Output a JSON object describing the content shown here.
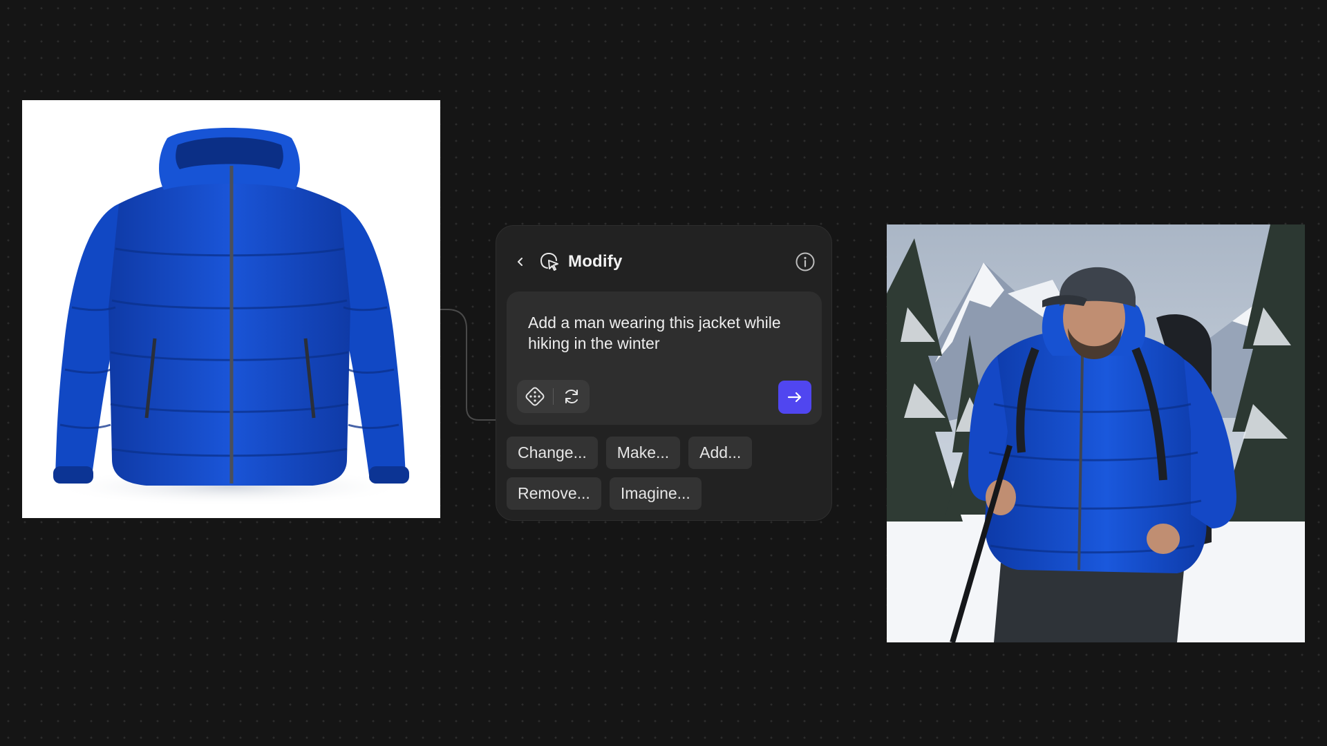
{
  "panel": {
    "title": "Modify",
    "back_icon": "chevron-left-icon",
    "mode_icon": "cursor-sparkle-icon",
    "info_icon": "info-icon",
    "prompt_text": "Add a man wearing this jacket while hiking in the winter",
    "tools": [
      {
        "icon": "dice-icon",
        "name": "randomize"
      },
      {
        "icon": "refresh-icon",
        "name": "regenerate"
      }
    ],
    "send_icon": "arrow-right-icon",
    "suggestions": [
      "Change...",
      "Make...",
      "Add...",
      "Remove...",
      "Imagine..."
    ]
  },
  "colors": {
    "background": "#151515",
    "panel": "#222222",
    "prompt_box": "#2e2e2e",
    "chip": "#333333",
    "accent": "#5046f0",
    "jacket_blue": "#1346c8"
  },
  "images": {
    "source": "blue puffer jacket product photo",
    "result": "man hiking in winter wearing blue puffer jacket"
  }
}
